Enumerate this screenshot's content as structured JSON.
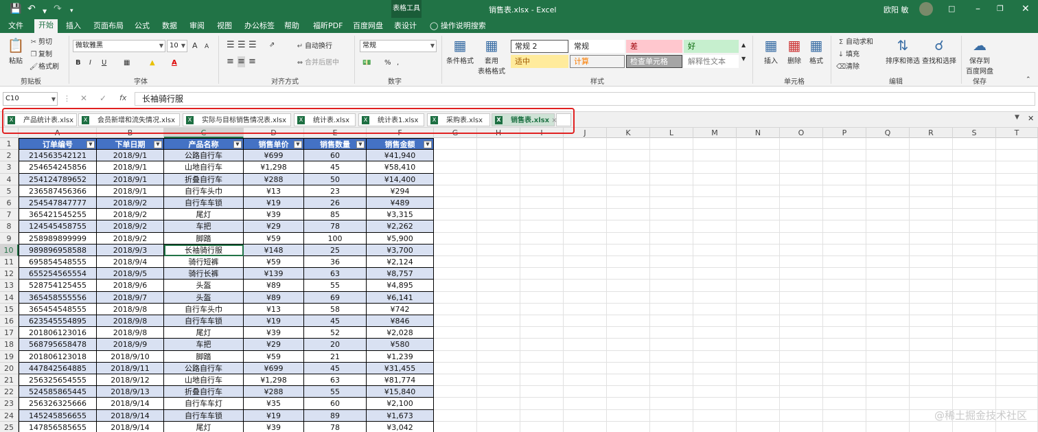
{
  "titlebar": {
    "tool_context": "表格工具",
    "window_title": "销售表.xlsx  -  Excel",
    "user_name": "欧阳 敏",
    "icons": [
      "save-icon",
      "undo-icon",
      "redo-icon",
      "customize-icon",
      "ribbon-display-icon",
      "minimize-icon",
      "restore-icon",
      "close-icon"
    ]
  },
  "ribbon_tabs": [
    "文件",
    "开始",
    "插入",
    "页面布局",
    "公式",
    "数据",
    "审阅",
    "视图",
    "办公标签",
    "帮助",
    "福昕PDF",
    "百度网盘",
    "表设计"
  ],
  "active_tab": "开始",
  "tell_me": "操作说明搜索",
  "clipboard": {
    "paste": "粘贴",
    "cut": "剪切",
    "copy": "复制",
    "format_painter": "格式刷",
    "label": "剪贴板"
  },
  "font": {
    "name": "微软雅黑",
    "size": "10",
    "grow": "A",
    "shrink": "A",
    "bold": "B",
    "italic": "I",
    "underline": "U",
    "label": "字体"
  },
  "alignment": {
    "wrap": "自动换行",
    "merge": "合并后居中",
    "label": "对齐方式"
  },
  "number": {
    "format": "常规",
    "percent": "%",
    "comma": ",",
    "label": "数字"
  },
  "styles": {
    "conditional": "条件格式",
    "table_format_1": "套用",
    "table_format_2": "表格格式",
    "cells": [
      {
        "text": "常规 2",
        "bg": "#ffffff",
        "fg": "#222222",
        "border": "#555555"
      },
      {
        "text": "常规",
        "bg": "#ffffff",
        "fg": "#222222",
        "border": "#ffffff"
      },
      {
        "text": "差",
        "bg": "#ffc7ce",
        "fg": "#9c0006",
        "border": "#ffc7ce"
      },
      {
        "text": "好",
        "bg": "#c6efce",
        "fg": "#006100",
        "border": "#c6efce"
      },
      {
        "text": "适中",
        "bg": "#ffeb9c",
        "fg": "#9c5700",
        "border": "#ffeb9c"
      },
      {
        "text": "计算",
        "bg": "#f2f2f2",
        "fg": "#fa7d00",
        "border": "#7f7f7f"
      },
      {
        "text": "检查单元格",
        "bg": "#a5a5a5",
        "fg": "#ffffff",
        "border": "#3f3f3f"
      },
      {
        "text": "解释性文本",
        "bg": "#ffffff",
        "fg": "#7f7f7f",
        "border": "#ffffff"
      }
    ],
    "label": "样式"
  },
  "cells_group": {
    "insert": "插入",
    "delete": "删除",
    "format": "格式",
    "label": "单元格"
  },
  "editing": {
    "autosum": "自动求和",
    "fill": "填充",
    "clear": "清除",
    "sort": "排序和筛选",
    "find": "查找和选择",
    "label": "编辑"
  },
  "save_group": {
    "btn_1": "保存到",
    "btn_2": "百度网盘",
    "label": "保存"
  },
  "formula_bar": {
    "name_box": "C10",
    "fx": "fx",
    "value": "长袖骑行服"
  },
  "workbook_tabs": [
    "产品统计表.xlsx",
    "会员新增和流失情况.xlsx",
    "实际与目标销售情况表.xlsx",
    "统计表.xlsx",
    "统计表1.xlsx",
    "采购表.xlsx",
    "销售表.xlsx"
  ],
  "active_workbook": "销售表.xlsx",
  "columns": [
    "A",
    "B",
    "C",
    "D",
    "E",
    "F",
    "G",
    "H",
    "I",
    "J",
    "K",
    "L",
    "M",
    "N",
    "O",
    "P",
    "Q",
    "R",
    "S",
    "T"
  ],
  "selected_column": "C",
  "selected_row": "10",
  "headers": [
    "订单编号",
    "下单日期",
    "产品名称",
    "销售单价",
    "销售数量",
    "销售金额"
  ],
  "rows": [
    [
      "214563542121",
      "2018/9/1",
      "公路自行车",
      "¥699",
      "60",
      "¥41,940"
    ],
    [
      "254654245856",
      "2018/9/1",
      "山地自行车",
      "¥1,298",
      "45",
      "¥58,410"
    ],
    [
      "254124789652",
      "2018/9/1",
      "折叠自行车",
      "¥288",
      "50",
      "¥14,400"
    ],
    [
      "236587456366",
      "2018/9/1",
      "自行车头巾",
      "¥13",
      "23",
      "¥294"
    ],
    [
      "254547847777",
      "2018/9/2",
      "自行车车锁",
      "¥19",
      "26",
      "¥489"
    ],
    [
      "365421545255",
      "2018/9/2",
      "尾灯",
      "¥39",
      "85",
      "¥3,315"
    ],
    [
      "124545458755",
      "2018/9/2",
      "车把",
      "¥29",
      "78",
      "¥2,262"
    ],
    [
      "258989899999",
      "2018/9/2",
      "脚踏",
      "¥59",
      "100",
      "¥5,900"
    ],
    [
      "989896958588",
      "2018/9/3",
      "长袖骑行服",
      "¥148",
      "25",
      "¥3,700"
    ],
    [
      "695854548555",
      "2018/9/4",
      "骑行短裤",
      "¥59",
      "36",
      "¥2,124"
    ],
    [
      "655254565554",
      "2018/9/5",
      "骑行长裤",
      "¥139",
      "63",
      "¥8,757"
    ],
    [
      "528754125455",
      "2018/9/6",
      "头盔",
      "¥89",
      "55",
      "¥4,895"
    ],
    [
      "365458555556",
      "2018/9/7",
      "头盔",
      "¥89",
      "69",
      "¥6,141"
    ],
    [
      "365454548555",
      "2018/9/8",
      "自行车头巾",
      "¥13",
      "58",
      "¥742"
    ],
    [
      "623545554895",
      "2018/9/8",
      "自行车车锁",
      "¥19",
      "45",
      "¥846"
    ],
    [
      "201806123016",
      "2018/9/8",
      "尾灯",
      "¥39",
      "52",
      "¥2,028"
    ],
    [
      "568795658478",
      "2018/9/9",
      "车把",
      "¥29",
      "20",
      "¥580"
    ],
    [
      "201806123018",
      "2018/9/10",
      "脚踏",
      "¥59",
      "21",
      "¥1,239"
    ],
    [
      "447842564885",
      "2018/9/11",
      "公路自行车",
      "¥699",
      "45",
      "¥31,455"
    ],
    [
      "256325654555",
      "2018/9/12",
      "山地自行车",
      "¥1,298",
      "63",
      "¥81,774"
    ],
    [
      "524585865445",
      "2018/9/13",
      "折叠自行车",
      "¥288",
      "55",
      "¥15,840"
    ],
    [
      "256326325666",
      "2018/9/14",
      "自行车车灯",
      "¥35",
      "60",
      "¥2,100"
    ],
    [
      "145245856655",
      "2018/9/14",
      "自行车车锁",
      "¥19",
      "89",
      "¥1,673"
    ],
    [
      "147856585655",
      "2018/9/14",
      "尾灯",
      "¥39",
      "78",
      "¥3,042"
    ]
  ],
  "watermark": "@稀土掘金技术社区",
  "colors": {
    "excel_green": "#217346",
    "table_header": "#4472c4",
    "band": "#d9e1f2",
    "highlight": "#e02020"
  }
}
